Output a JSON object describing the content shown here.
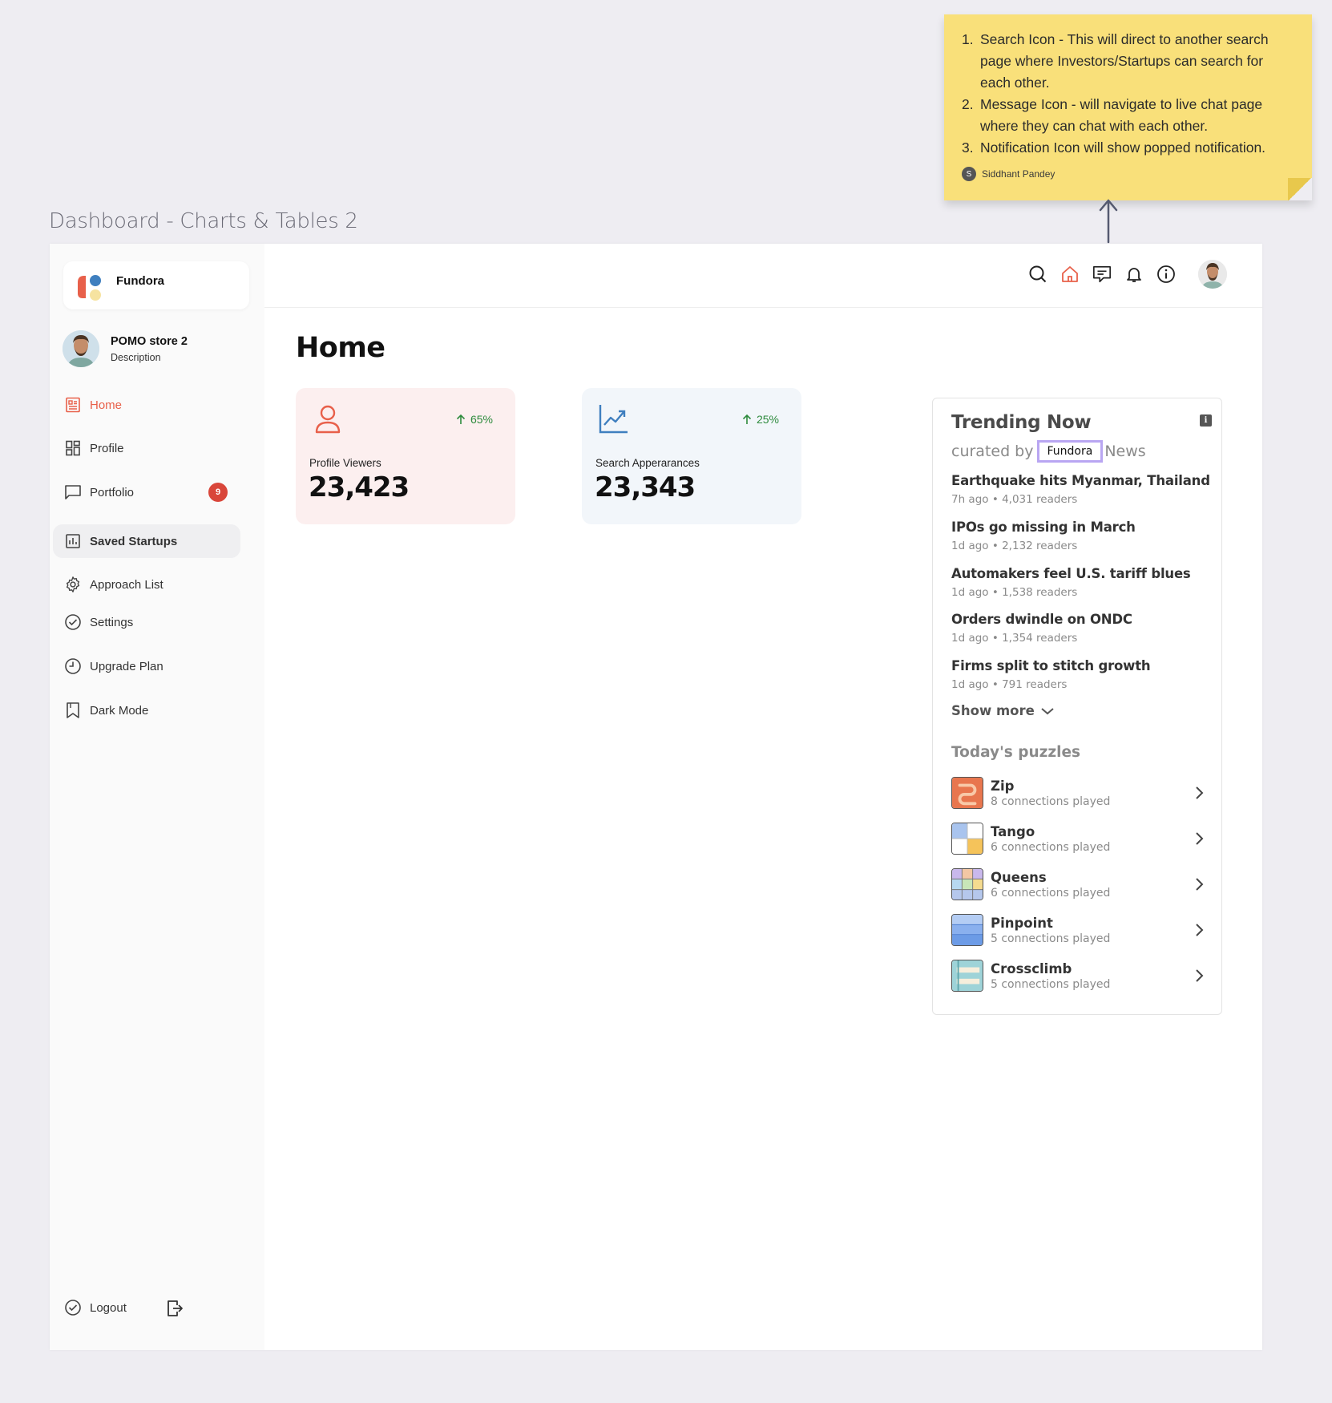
{
  "frame_title": "Dashboard - Charts & Tables 2",
  "sticky_note": {
    "items": [
      "Search Icon - This will direct to another search page where Investors/Startups can search for each other.",
      "Message Icon - will navigate to live chat page where they can chat with each other.",
      "Notification Icon will show popped notification."
    ],
    "author_initial": "S",
    "author": "Siddhant Pandey"
  },
  "sidebar": {
    "brand": "Fundora",
    "user": {
      "name": "POMO store 2",
      "description": "Description"
    },
    "items": [
      {
        "label": "Home",
        "icon": "news-icon"
      },
      {
        "label": "Profile",
        "icon": "dashboard-icon"
      },
      {
        "label": "Portfolio",
        "icon": "message-square-icon",
        "badge": "9"
      },
      {
        "label": "Saved Startups",
        "icon": "bar-chart-icon"
      },
      {
        "label": "Approach List",
        "icon": "gear-icon"
      },
      {
        "label": "Settings",
        "icon": "check-circle-icon"
      },
      {
        "label": "Upgrade Plan",
        "icon": "clock-icon"
      },
      {
        "label": "Dark Mode",
        "icon": "bookmark-icon"
      }
    ],
    "logout": "Logout"
  },
  "header": {
    "icons": [
      "search-icon",
      "home-icon",
      "message-icon",
      "bell-icon",
      "info-icon",
      "avatar"
    ]
  },
  "main": {
    "title": "Home",
    "stats": [
      {
        "label": "Profile Viewers",
        "value": "23,423",
        "delta": "65%",
        "icon": "user-icon"
      },
      {
        "label": "Search Apperarances",
        "value": "23,343",
        "delta": "25%",
        "icon": "trend-up-icon"
      }
    ]
  },
  "trending": {
    "title": "Trending Now",
    "curated_prefix": "curated by",
    "curated_brand": "Fundora",
    "curated_suffix": "News",
    "news": [
      {
        "headline": "Earthquake hits Myanmar, Thailand",
        "meta": "7h ago • 4,031 readers"
      },
      {
        "headline": "IPOs go missing in March",
        "meta": "1d ago • 2,132 readers"
      },
      {
        "headline": "Automakers feel U.S. tariff blues",
        "meta": "1d ago • 1,538 readers"
      },
      {
        "headline": "Orders dwindle on ONDC",
        "meta": "1d ago • 1,354 readers"
      },
      {
        "headline": "Firms split to stitch growth",
        "meta": "1d ago • 791 readers"
      }
    ],
    "show_more": "Show more",
    "puzzles_title": "Today's puzzles",
    "puzzles": [
      {
        "name": "Zip",
        "meta": "8 connections played"
      },
      {
        "name": "Tango",
        "meta": "6 connections played"
      },
      {
        "name": "Queens",
        "meta": "6 connections played"
      },
      {
        "name": "Pinpoint",
        "meta": "5 connections played"
      },
      {
        "name": "Crossclimb",
        "meta": "5 connections played"
      }
    ]
  },
  "colors": {
    "accent": "#E8604A",
    "blue": "#3F7FBF",
    "sticky": "#F9E07A",
    "badge": "#D9463A",
    "up": "#2E8B3D"
  }
}
